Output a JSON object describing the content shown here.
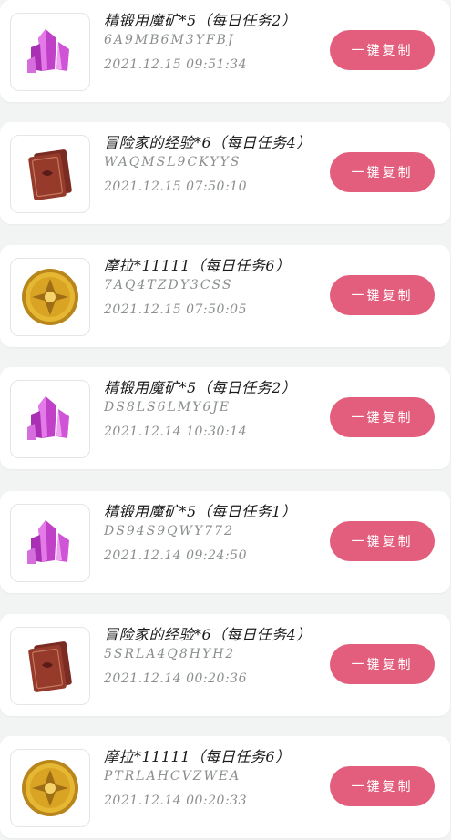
{
  "items": [
    {
      "icon": "magic-crystal-icon",
      "title": "精锻用魔矿*5（每日任务2）",
      "code": "6A9MB6M3YFBJ",
      "time": "2021.12.15 09:51:34",
      "button": "一键复制"
    },
    {
      "icon": "adventurer-book-icon",
      "title": "冒险家的经验*6（每日任务4）",
      "code": "WAQMSL9CKYYS",
      "time": "2021.12.15 07:50:10",
      "button": "一键复制"
    },
    {
      "icon": "mora-coin-icon",
      "title": "摩拉*11111（每日任务6）",
      "code": "7AQ4TZDY3CSS",
      "time": "2021.12.15 07:50:05",
      "button": "一键复制"
    },
    {
      "icon": "magic-crystal-icon",
      "title": "精锻用魔矿*5（每日任务2）",
      "code": "DS8LS6LMY6JE",
      "time": "2021.12.14 10:30:14",
      "button": "一键复制"
    },
    {
      "icon": "magic-crystal-icon",
      "title": "精锻用魔矿*5（每日任务1）",
      "code": "DS94S9QWY772",
      "time": "2021.12.14 09:24:50",
      "button": "一键复制"
    },
    {
      "icon": "adventurer-book-icon",
      "title": "冒险家的经验*6（每日任务4）",
      "code": "5SRLA4Q8HYH2",
      "time": "2021.12.14 00:20:36",
      "button": "一键复制"
    },
    {
      "icon": "mora-coin-icon",
      "title": "摩拉*11111（每日任务6）",
      "code": "PTRLAHCVZWEA",
      "time": "2021.12.14 00:20:33",
      "button": "一键复制"
    }
  ]
}
